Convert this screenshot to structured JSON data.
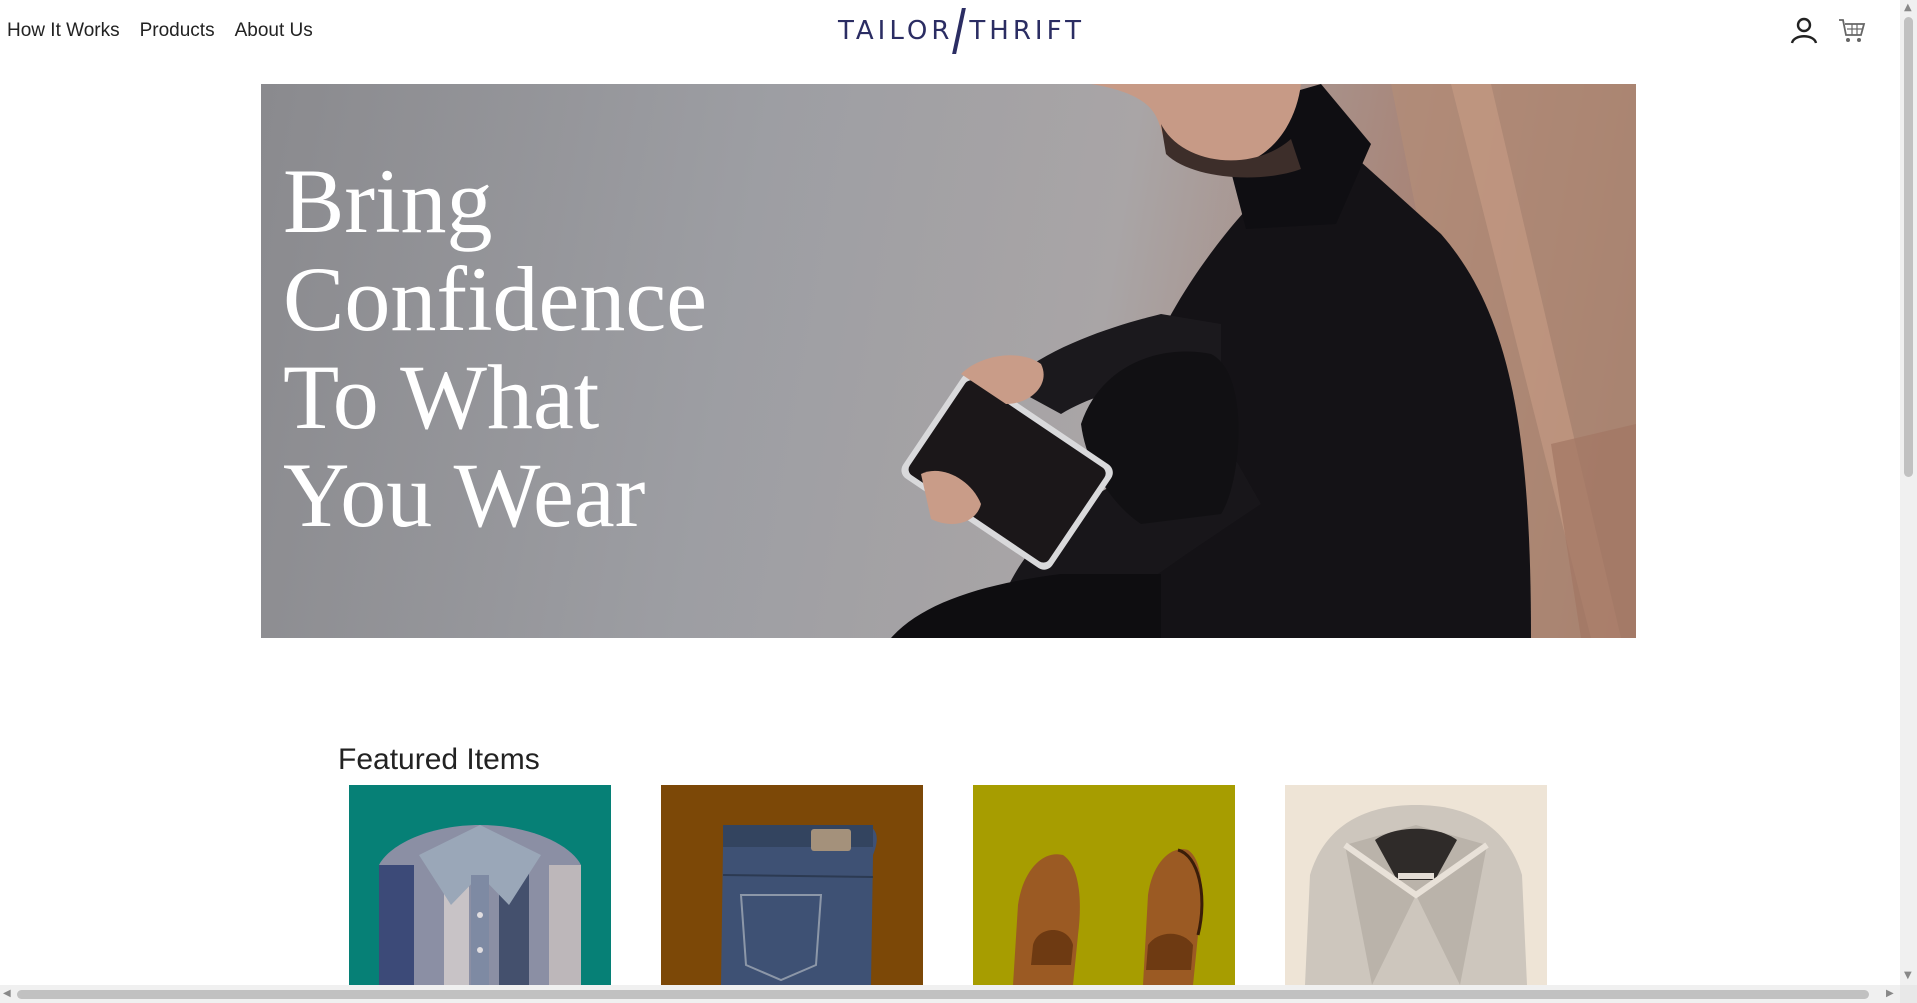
{
  "nav": {
    "items": [
      {
        "label": "How It Works"
      },
      {
        "label": "Products"
      },
      {
        "label": "About Us"
      }
    ]
  },
  "logo": {
    "left": "TAILOR",
    "right": "THRIFT",
    "color": "#2b2d63"
  },
  "header_icons": [
    "user-icon",
    "cart-icon"
  ],
  "hero": {
    "title": "Bring\nConfidence\nTo What\n You Wear"
  },
  "featured": {
    "title": "Featured Items",
    "items": [
      {
        "name": "plaid-shirt",
        "bg": "#068076"
      },
      {
        "name": "denim-jeans",
        "bg": "#7c4807"
      },
      {
        "name": "leather-shoes",
        "bg": "#a79d00"
      },
      {
        "name": "knit-cardigan",
        "bg": "#eee4d6"
      }
    ]
  }
}
